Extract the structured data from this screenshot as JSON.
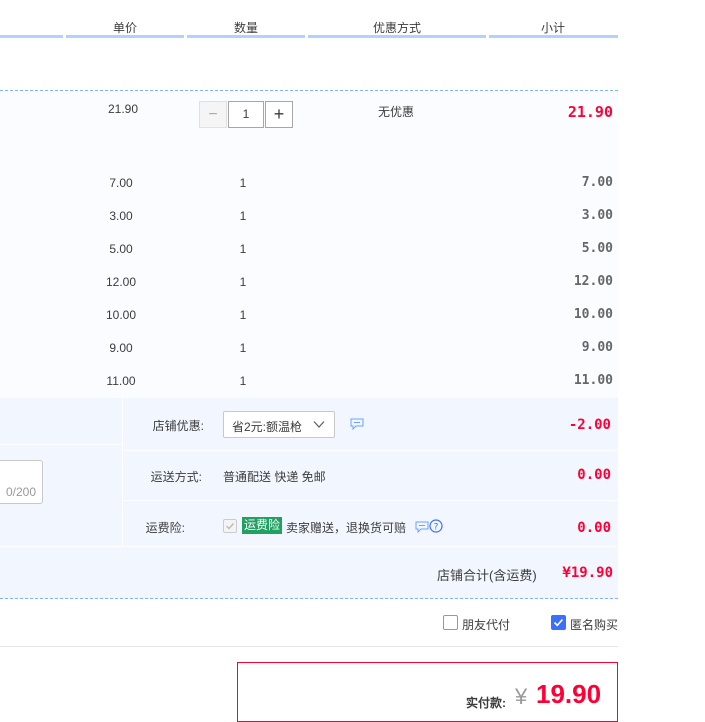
{
  "header": {
    "columns": [
      "单价",
      "数量",
      "优惠方式",
      "小计"
    ]
  },
  "main_item": {
    "price": "21.90",
    "qty": "1",
    "discount": "无优惠",
    "subtotal": "21.90",
    "minus": "−",
    "plus": "+"
  },
  "sub_items": [
    {
      "price": "7.00",
      "qty": "1",
      "subtotal": "7.00"
    },
    {
      "price": "3.00",
      "qty": "1",
      "subtotal": "3.00"
    },
    {
      "price": "5.00",
      "qty": "1",
      "subtotal": "5.00"
    },
    {
      "price": "12.00",
      "qty": "1",
      "subtotal": "12.00"
    },
    {
      "price": "10.00",
      "qty": "1",
      "subtotal": "10.00"
    },
    {
      "price": "9.00",
      "qty": "1",
      "subtotal": "9.00"
    },
    {
      "price": "11.00",
      "qty": "1",
      "subtotal": "11.00"
    }
  ],
  "store": {
    "promo_label": "店铺优惠:",
    "promo_select": "省2元:额温枪",
    "promo_amount": "-2.00",
    "shipping_label": "运送方式:",
    "shipping_value": "普通配送 快递 免邮",
    "shipping_amount": "0.00",
    "insurance_label": "运费险:",
    "insurance_badge": "运费险",
    "insurance_text": "卖家赠送，退换货可赔",
    "insurance_amount": "0.00",
    "message_counter": "0/200",
    "total_label": "店铺合计(含运费)",
    "total_value": "¥19.90"
  },
  "options": {
    "friend_pay": "朋友代付",
    "anonymous": "匿名购买"
  },
  "payment": {
    "label": "实付款:",
    "currency": "¥",
    "amount": "19.90"
  },
  "colors": {
    "price_red": "#ff0036",
    "header_line": "#b2d1ff",
    "accent_blue": "#3d6fff",
    "badge_green": "#20a162"
  }
}
